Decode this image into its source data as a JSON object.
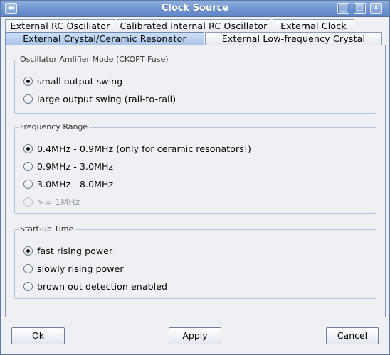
{
  "window": {
    "title": "Clock Source"
  },
  "tabs": [
    {
      "label": "External RC Oscillator"
    },
    {
      "label": "Calibrated Internal RC Oscillator"
    },
    {
      "label": "External Clock"
    },
    {
      "label": "External Crystal/Ceramic Resonator",
      "selected": true
    },
    {
      "label": "External Low-frequency Crystal"
    }
  ],
  "groups": {
    "amp_mode": {
      "title": "Oscillator Amlifier Mode (CKOPT Fuse)",
      "options": [
        {
          "label": "small output swing",
          "checked": true
        },
        {
          "label": "large output swing (rail-to-rail)",
          "checked": false
        }
      ]
    },
    "freq_range": {
      "title": "Frequency Range",
      "options": [
        {
          "label": "0.4MHz - 0.9MHz (only for ceramic resonators!)",
          "checked": true
        },
        {
          "label": "0.9MHz - 3.0MHz",
          "checked": false
        },
        {
          "label": "3.0MHz - 8.0MHz",
          "checked": false
        },
        {
          "label": ">= 1MHz",
          "checked": false,
          "disabled": true
        }
      ]
    },
    "startup": {
      "title": "Start-up Time",
      "options": [
        {
          "label": "fast rising power",
          "checked": true
        },
        {
          "label": "slowly rising power",
          "checked": false
        },
        {
          "label": "brown out detection enabled",
          "checked": false
        }
      ]
    }
  },
  "buttons": {
    "ok": "Ok",
    "apply": "Apply",
    "cancel": "Cancel"
  },
  "colors": {
    "titlebar": "#6f94cf",
    "selected_tab": "#a8c4ea",
    "window_bg": "#eef0f4"
  }
}
